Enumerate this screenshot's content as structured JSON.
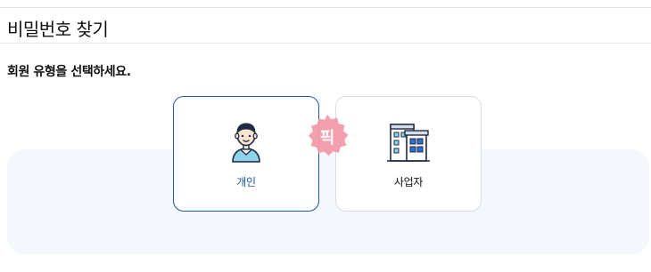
{
  "page": {
    "title": "비밀번호 찾기",
    "instruction": "회원 유형을 선택하세요."
  },
  "options": [
    {
      "label": "개인",
      "icon": "person-avatar-icon",
      "selected": true
    },
    {
      "label": "사업자",
      "icon": "office-building-icon",
      "selected": false
    }
  ],
  "badge": {
    "text": "픽"
  },
  "colors": {
    "accent": "#1c56a8",
    "panel_bg": "#f4f7fc",
    "badge_pink": "#f39aaa",
    "card_border": "#dadde3"
  }
}
